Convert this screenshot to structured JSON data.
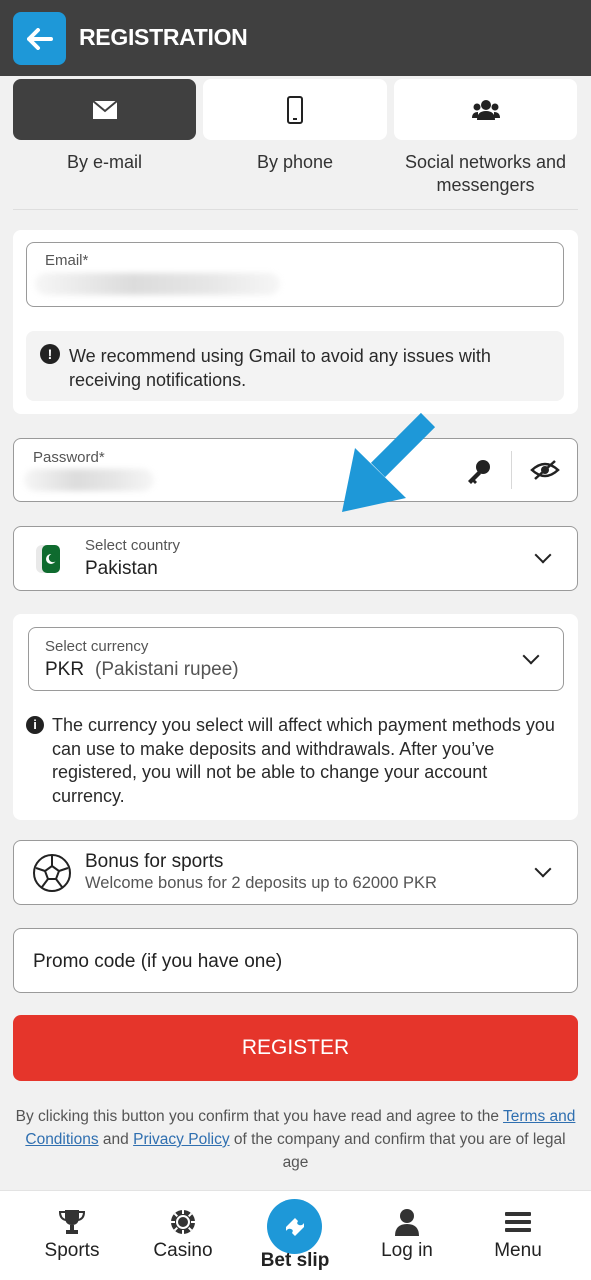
{
  "header": {
    "title": "REGISTRATION",
    "back_icon": "arrow-left-icon"
  },
  "tabs": [
    {
      "label": "By e-mail",
      "icon": "envelope-icon",
      "active": true
    },
    {
      "label": "By phone",
      "icon": "phone-icon",
      "active": false
    },
    {
      "label": "Social networks and messengers",
      "icon": "users-icon",
      "active": false
    }
  ],
  "email": {
    "label": "Email*",
    "notice": "We recommend using Gmail to avoid any issues with receiving notifications."
  },
  "password": {
    "label": "Password*",
    "key_icon": "key-icon",
    "visibility_icon": "eye-off-icon"
  },
  "country": {
    "label": "Select country",
    "value": "Pakistan",
    "flag_icon": "pakistan-flag-icon"
  },
  "currency": {
    "label": "Select currency",
    "code": "PKR",
    "name": "(Pakistani rupee)",
    "notice": "The currency you select will affect which payment methods you can use to make deposits and withdrawals. After you’ve registered, you will not be able to change your account currency."
  },
  "bonus": {
    "title": "Bonus for sports",
    "subtitle": "Welcome bonus for 2 deposits up to 62000 PKR",
    "icon": "soccer-ball-icon"
  },
  "promo": {
    "placeholder": "Promo code (if you have one)"
  },
  "register": {
    "label": "REGISTER"
  },
  "legal": {
    "part1": "By clicking this button you confirm that you have read and agree to the ",
    "terms_link": "Terms and Conditions",
    "part2": " and ",
    "privacy_link": "Privacy Policy",
    "part3": " of the company and confirm that you are of legal age"
  },
  "bottom_nav": [
    {
      "label": "Sports",
      "icon": "trophy-icon"
    },
    {
      "label": "Casino",
      "icon": "casino-chip-icon"
    },
    {
      "label": "Bet slip",
      "icon": "ticket-icon"
    },
    {
      "label": "Log in",
      "icon": "user-icon"
    },
    {
      "label": "Menu",
      "icon": "hamburger-icon"
    }
  ],
  "colors": {
    "accent": "#1e98d8",
    "register": "#e5352b",
    "header": "#404040"
  }
}
